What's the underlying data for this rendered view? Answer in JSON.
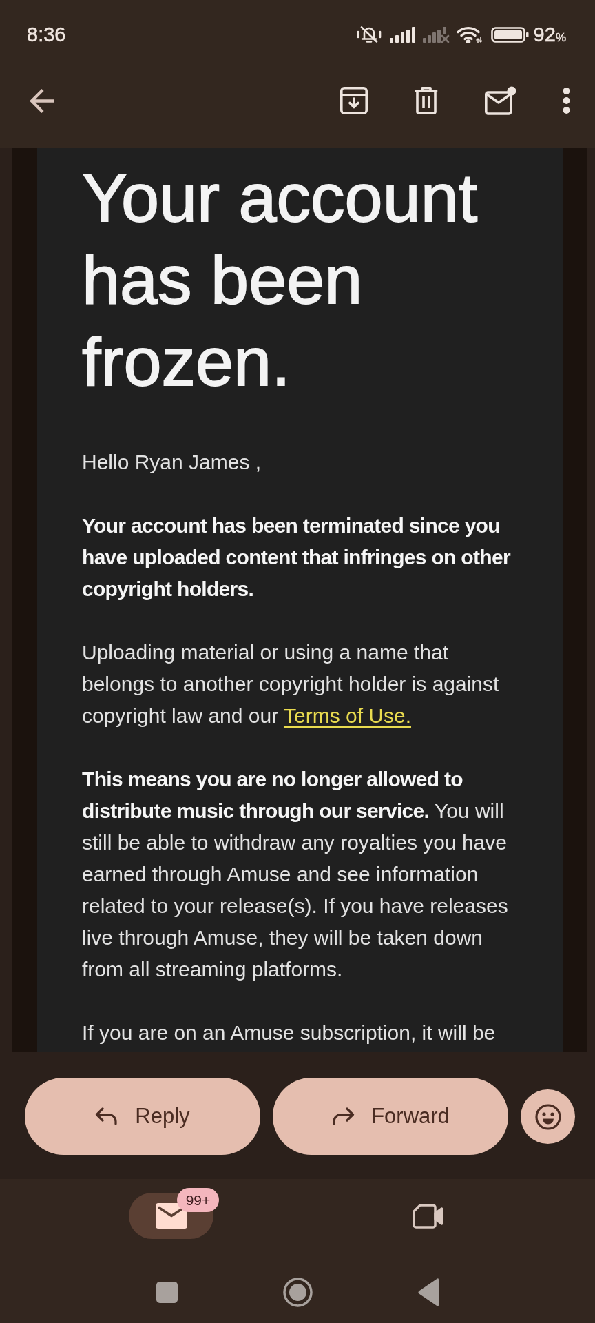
{
  "status_bar": {
    "time": "8:36",
    "battery_value": "92",
    "battery_unit": "%"
  },
  "email": {
    "heading": "Your account has been frozen.",
    "paragraphs": [
      {
        "kind": "plain",
        "text": "Hello Ryan James ,"
      },
      {
        "kind": "bold",
        "text": "Your account has been terminated since you have uploaded content that infringes on other copyright holders."
      },
      {
        "kind": "plain",
        "text": "Uploading material or using a name that belongs to another copyright holder is against copyright law and our",
        "link": "Terms of Use."
      },
      {
        "kind": "plain",
        "text": "**This means you are no longer allowed to distribute music through our service.** You will still be able to withdraw any royalties you have earned through Amuse and see information related to your release(s). If you have releases live through Amuse, they will be taken down from all streaming platforms."
      },
      {
        "kind": "plain",
        "text": "If you are on an Amuse subscription, it will be"
      }
    ]
  },
  "actions": [
    {
      "kind": "reply",
      "label": "Reply"
    },
    {
      "kind": "forward",
      "label": "Forward"
    },
    {
      "kind": "emoji"
    }
  ],
  "bottom_nav": [
    {
      "kind": "mail",
      "selected": true,
      "badge": "99+"
    },
    {
      "kind": "video",
      "selected": false
    }
  ]
}
